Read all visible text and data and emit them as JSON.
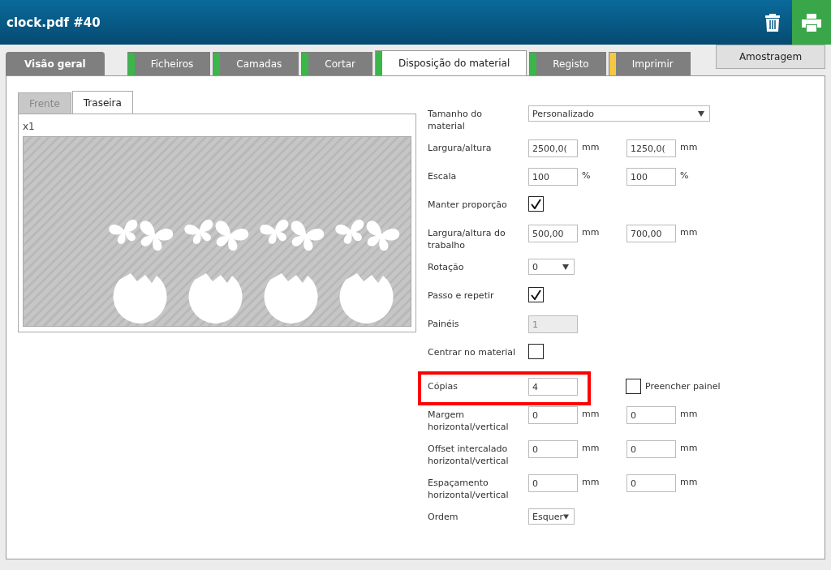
{
  "header": {
    "title": "clock.pdf #40"
  },
  "tabs": [
    {
      "label": "Visão geral",
      "selected": false,
      "kind": "overview"
    },
    {
      "label": "Ficheiros",
      "selected": false,
      "kind": "step",
      "color": "#3cb54a"
    },
    {
      "label": "Camadas",
      "selected": false,
      "kind": "step",
      "color": "#3cb54a"
    },
    {
      "label": "Cortar",
      "selected": false,
      "kind": "step",
      "color": "#3cb54a"
    },
    {
      "label": "Disposição do material",
      "selected": true,
      "kind": "step",
      "color": "#3cb54a"
    },
    {
      "label": "Registo",
      "selected": false,
      "kind": "step",
      "color": "#3cb54a"
    },
    {
      "label": "Imprimir",
      "selected": false,
      "kind": "step",
      "color": "#f5c842"
    }
  ],
  "sample_button": "Amostragem",
  "preview": {
    "side_tabs": [
      {
        "label": "Frente",
        "selected": false
      },
      {
        "label": "Traseira",
        "selected": true
      }
    ],
    "count": "x1"
  },
  "form": [
    {
      "kind": "select",
      "label": "Tamanho do material",
      "value": "Personalizado",
      "wide": true
    },
    {
      "kind": "pair",
      "label": "Largura/altura",
      "values": [
        "2500,0(",
        "1250,0("
      ],
      "units": [
        "mm",
        "mm"
      ]
    },
    {
      "kind": "pair",
      "label": "Escala",
      "values": [
        "100",
        "100"
      ],
      "units": [
        "%",
        "%"
      ]
    },
    {
      "kind": "checkbox",
      "label": "Manter proporção",
      "checked": true
    },
    {
      "kind": "pair",
      "label": "Largura/altura do trabalho",
      "values": [
        "500,00",
        "700,00"
      ],
      "units": [
        "mm",
        "mm"
      ]
    },
    {
      "kind": "select",
      "label": "Rotação",
      "value": "0",
      "wide": false
    },
    {
      "kind": "checkbox",
      "label": "Passo e repetir",
      "checked": true
    },
    {
      "kind": "field",
      "label": "Painéis",
      "value": "1",
      "disabled": true
    },
    {
      "kind": "checkbox",
      "label": "Centrar no material",
      "checked": false
    },
    {
      "kind": "field",
      "label": "Cópias",
      "value": "4",
      "disabled": false,
      "highlighted": true,
      "extra": {
        "label": "Preencher painel",
        "checked": false
      }
    },
    {
      "kind": "pair",
      "label": "Margem horizontal/vertical",
      "values": [
        "0",
        "0"
      ],
      "units": [
        "mm",
        "mm"
      ]
    },
    {
      "kind": "pair",
      "label": "Offset intercalado horizontal/vertical",
      "values": [
        "0",
        "0"
      ],
      "units": [
        "mm",
        "mm"
      ]
    },
    {
      "kind": "pair",
      "label": "Espaçamento horizontal/vertical",
      "values": [
        "0",
        "0"
      ],
      "units": [
        "mm",
        "mm"
      ]
    },
    {
      "kind": "select",
      "label": "Ordem",
      "value": "Esquer",
      "wide": false
    }
  ]
}
